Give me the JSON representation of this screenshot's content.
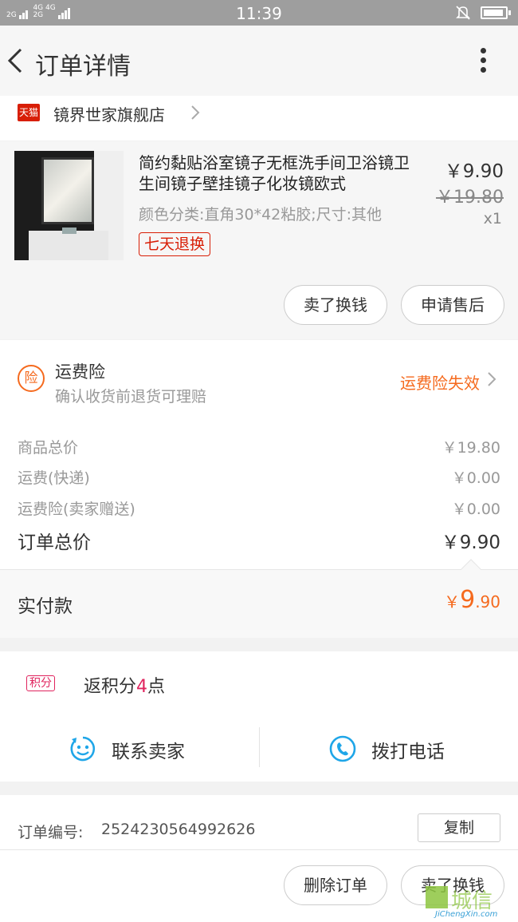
{
  "status_bar": {
    "time": "11:39",
    "signal_left": "2G",
    "signal_right_top": "4G 4G",
    "signal_right_bottom": "2G"
  },
  "nav": {
    "title": "订单详情"
  },
  "shop": {
    "badge": "天猫",
    "name": "镜界世家旗舰店"
  },
  "product": {
    "title": "简约黏贴浴室镜子无框洗手间卫浴镜卫生间镜子壁挂镜子化妆镜欧式",
    "spec": "颜色分类:直角30*42粘胶;尺寸:其他",
    "tag": "七天退换",
    "price": "￥9.90",
    "original_price": "￥19.80",
    "quantity": "x1",
    "buttons": {
      "sell": "卖了换钱",
      "after_sale": "申请售后"
    }
  },
  "insurance": {
    "icon_char": "险",
    "title": "运费险",
    "subtitle": "确认收货前退货可理赔",
    "status": "运费险失效"
  },
  "costs": [
    {
      "label": "商品总价",
      "value": "￥19.80"
    },
    {
      "label": "运费(快递)",
      "value": "￥0.00"
    },
    {
      "label": "运费险(卖家赠送)",
      "value": "￥0.00"
    }
  ],
  "total": {
    "label": "订单总价",
    "value": "￥9.90"
  },
  "paid": {
    "label": "实付款",
    "currency": "￥",
    "big": "9",
    "small": ".90"
  },
  "points": {
    "badge": "积分",
    "prefix": "返积分",
    "count": "4",
    "suffix": "点"
  },
  "actions": {
    "contact": "联系卖家",
    "call": "拨打电话"
  },
  "order": {
    "label": "订单编号:",
    "number": "2524230564992626",
    "copy": "复制"
  },
  "bottom_buttons": {
    "delete": "删除订单",
    "sell": "卖了换钱"
  },
  "watermark": {
    "cn": "城信",
    "en": "JiChengXin.com"
  },
  "colors": {
    "accent": "#f56a1e",
    "tmall": "#d81e06",
    "points": "#e0245e",
    "icon_blue": "#1fa6e8"
  }
}
